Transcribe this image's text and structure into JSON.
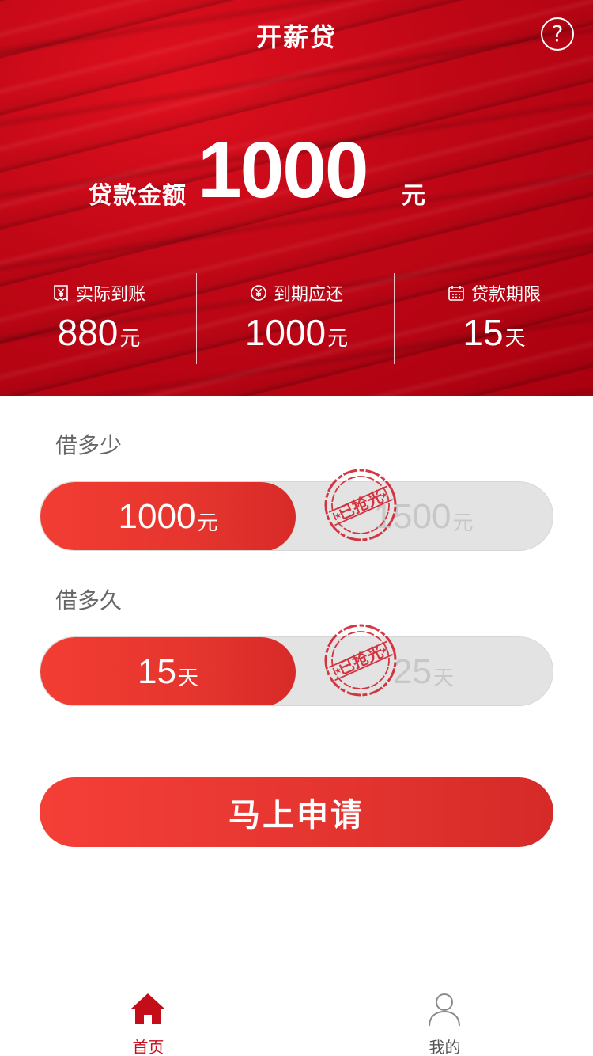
{
  "header": {
    "title": "开薪贷",
    "help_label": "?"
  },
  "loan": {
    "amount_label": "贷款金额",
    "amount_value": "1000",
    "amount_unit": "元"
  },
  "stats": [
    {
      "icon": "yen-receipt-icon",
      "label": "实际到账",
      "value": "880",
      "unit": "元"
    },
    {
      "icon": "yen-circle-icon",
      "label": "到期应还",
      "value": "1000",
      "unit": "元"
    },
    {
      "icon": "calendar-icon",
      "label": "贷款期限",
      "value": "15",
      "unit": "天"
    }
  ],
  "amount_selector": {
    "label": "借多少",
    "options": [
      {
        "value": "1000",
        "unit": "元",
        "state": "selected"
      },
      {
        "value": "1500",
        "unit": "元",
        "state": "sold-out"
      }
    ],
    "stamp_text": "已抢光"
  },
  "term_selector": {
    "label": "借多久",
    "options": [
      {
        "value": "15",
        "unit": "天",
        "state": "selected"
      },
      {
        "value": "25",
        "unit": "天",
        "state": "sold-out"
      }
    ],
    "stamp_text": "已抢光"
  },
  "apply_button": {
    "label": "马上申请"
  },
  "tabbar": {
    "items": [
      {
        "label": "首页",
        "icon": "home-icon",
        "active": true
      },
      {
        "label": "我的",
        "icon": "user-icon",
        "active": false
      }
    ]
  },
  "colors": {
    "brand_red": "#e5352e",
    "active_tab": "#c30d18",
    "inactive_text": "#c7c7c7",
    "stamp_red": "#d2232f"
  }
}
